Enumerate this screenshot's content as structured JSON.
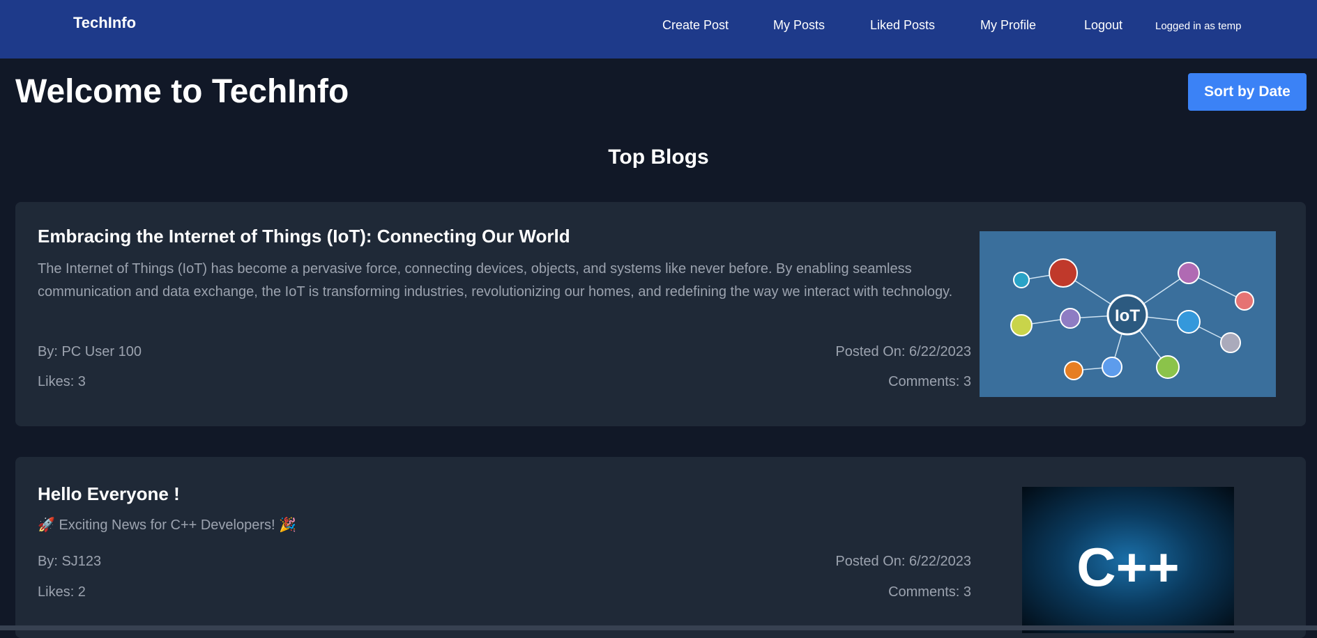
{
  "nav": {
    "brand": "TechInfo",
    "links": [
      "Create Post",
      "My Posts",
      "Liked Posts",
      "My Profile",
      "Logout"
    ],
    "user": "Logged in as temp"
  },
  "page": {
    "title": "Welcome to TechInfo",
    "sort_label": "Sort by Date",
    "section": "Top Blogs"
  },
  "posts": [
    {
      "title": "Embracing the Internet of Things (IoT): Connecting Our World",
      "body": "The Internet of Things (IoT) has become a pervasive force, connecting devices, objects, and systems like never before. By enabling seamless communication and data exchange, the IoT is transforming industries, revolutionizing our homes, and redefining the way we interact with technology.",
      "author": "By: PC User 100",
      "posted": "Posted On: 6/22/2023",
      "likes": "Likes: 3",
      "comments": "Comments: 3",
      "image_label": "IoT"
    },
    {
      "title": "Hello Everyone !",
      "body": "🚀 Exciting News for C++ Developers! 🎉",
      "author": "By: SJ123",
      "posted": "Posted On: 6/22/2023",
      "likes": "Likes: 2",
      "comments": "Comments: 3",
      "image_label": "C++"
    }
  ],
  "colors": {
    "nav": "#1e3a8a",
    "bg": "#111827",
    "card": "#1f2937",
    "accent": "#3b82f6"
  }
}
